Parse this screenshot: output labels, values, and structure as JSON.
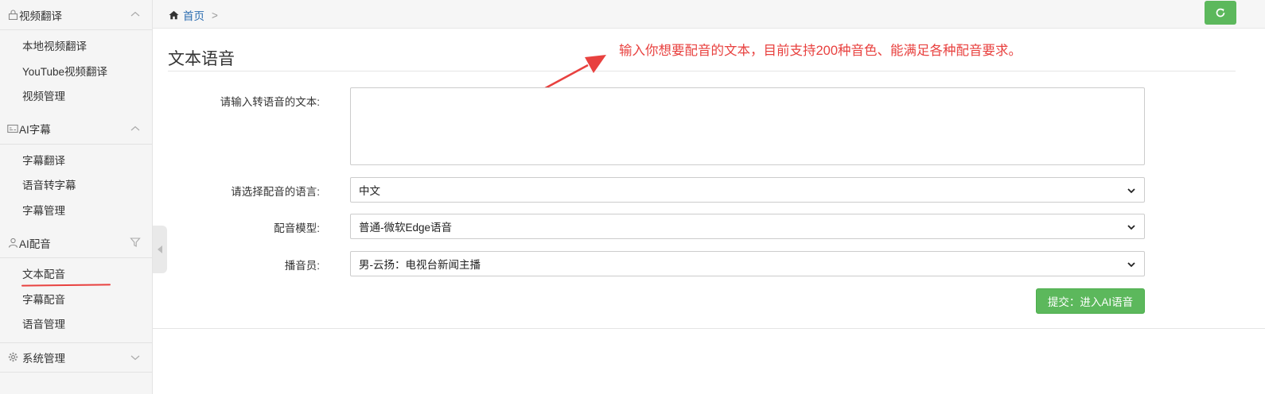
{
  "sidebar": {
    "groups": [
      {
        "label": "视频翻译",
        "icon": "lock-icon",
        "expanded": true,
        "items": [
          {
            "label": "本地视频翻译"
          },
          {
            "label": "YouTube视频翻译"
          },
          {
            "label": "视频管理"
          }
        ]
      },
      {
        "label": "AI字幕",
        "icon": "subtitle-icon",
        "expanded": true,
        "items": [
          {
            "label": "字幕翻译"
          },
          {
            "label": "语音转字幕"
          },
          {
            "label": "字幕管理"
          }
        ]
      },
      {
        "label": "AI配音",
        "icon": "user-icon",
        "expanded": true,
        "items": [
          {
            "label": "文本配音",
            "active": true
          },
          {
            "label": "字幕配音"
          },
          {
            "label": "语音管理"
          }
        ]
      },
      {
        "label": "系统管理",
        "icon": "gear-icon",
        "expanded": false,
        "items": []
      }
    ]
  },
  "breadcrumb": {
    "home": "首页",
    "separator": ">"
  },
  "page": {
    "title": "文本语音",
    "annotation": "输入你想要配音的文本，目前支持200种音色、能满足各种配音要求。"
  },
  "form": {
    "text_label": "请输入转语音的文本:",
    "text_value": "",
    "language_label": "请选择配音的语言:",
    "language_value": "中文",
    "model_label": "配音模型:",
    "model_value": "普通-微软Edge语音",
    "voice_label": "播音员:",
    "voice_value": "男-云扬：电视台新闻主播",
    "submit_label": "提交：进入AI语音"
  },
  "colors": {
    "accent_green": "#5cb85c",
    "annotation_red": "#e8413f",
    "link_blue": "#2b6cb0"
  }
}
